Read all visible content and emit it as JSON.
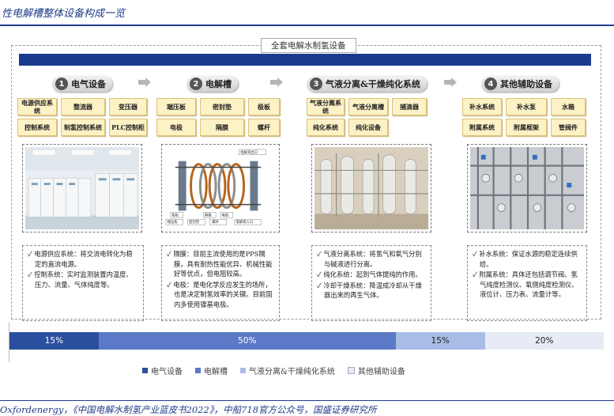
{
  "header": {
    "title": "性电解槽整体设备构成一览"
  },
  "footer": {
    "source": "Oxfordenergy，《中国电解水制氢产业蓝皮书2022》，中船718官方公众号，国盛证券研究所"
  },
  "diagram": {
    "label": "全套电解水制氢设备",
    "sections": [
      {
        "num": "1",
        "title": "电气设备",
        "components": [
          "电源供应系统",
          "整流器",
          "变压器",
          "控制系统",
          "制氢控制系统",
          "PLC控制柜"
        ],
        "desc": [
          "电源供应系统：将交流电转化为稳定的直流电源。",
          "控制系统：实时监测装置内温度、压力、流量、气体纯度等。"
        ]
      },
      {
        "num": "2",
        "title": "电解槽",
        "components": [
          "端压板",
          "密封垫",
          "极板",
          "电极",
          "隔膜",
          "螺杆"
        ],
        "desc": [
          "隔膜：目前主流使用的是PPS隔膜，具有耐热性能优异、机械性能好等优点，但电阻较高。",
          "电极：是电化学反应发生的场所，也是决定制氢效率的关键。目前国内多使用镍基电极。"
        ]
      },
      {
        "num": "3",
        "title": "气液分离&干燥纯化系统",
        "components": [
          "气液分离系统",
          "气液分离槽",
          "捕滴器",
          "纯化系统",
          "纯化设备"
        ],
        "desc": [
          "气液分离系统：将氢气和氧气分别与碱液进行分离。",
          "纯化系统：起到气体提纯的作用。",
          "冷却干燥系统：降温成冷却从干燥器出来的再生气体。"
        ]
      },
      {
        "num": "4",
        "title": "其他辅助设备",
        "components": [
          "补水系统",
          "补水泵",
          "水箱",
          "附属系统",
          "附属框架",
          "管阀件"
        ],
        "desc": [
          "补水系统：保证水源的稳定连续供给。",
          "附属系统：具体还包括调节阀、氢气纯度检测仪、氧侧纯度检测仪、液位计、压力表、流量计等。"
        ]
      }
    ],
    "photo2_labels": [
      "端压板",
      "密封垫",
      "螺杆",
      "极板",
      "隔膜",
      "电极",
      "电解液入口",
      "电解液出口"
    ]
  },
  "chart_data": {
    "type": "bar",
    "orientation": "horizontal-stacked",
    "categories": [
      "电气设备",
      "电解槽",
      "气液分离&干燥纯化系统",
      "其他辅助设备"
    ],
    "values": [
      15,
      50,
      15,
      20
    ],
    "labels": [
      "15%",
      "50%",
      "15%",
      "20%"
    ],
    "colors": [
      "#2a4f9e",
      "#5b79c7",
      "#a8bde6",
      "#e6ebf5"
    ]
  }
}
